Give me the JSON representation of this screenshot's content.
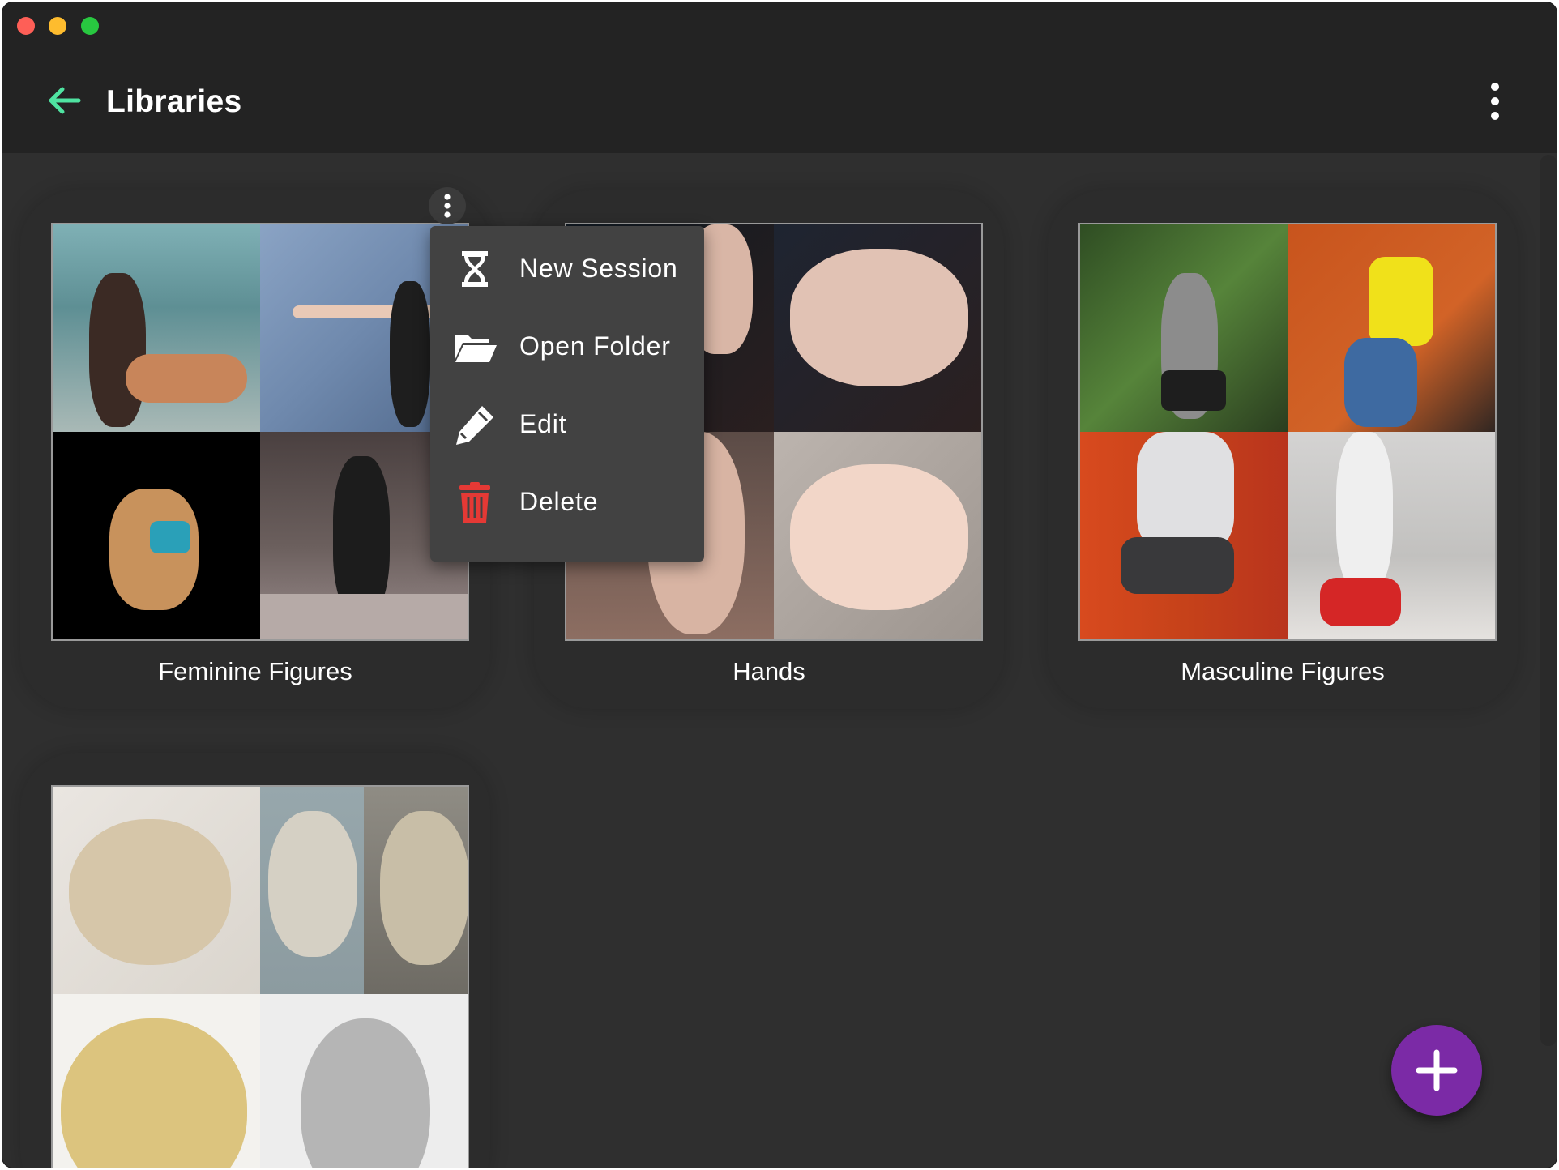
{
  "app": {
    "title": "Libraries"
  },
  "header": {
    "back_icon": "arrow-left-icon",
    "menu_icon": "more-vert-icon",
    "accent": "#4fe3a1"
  },
  "libraries": [
    {
      "label": "Feminine Figures"
    },
    {
      "label": "Hands"
    },
    {
      "label": "Masculine Figures"
    },
    {
      "label": ""
    }
  ],
  "context_menu": {
    "items": [
      {
        "label": "New Session",
        "icon": "hourglass-icon"
      },
      {
        "label": "Open Folder",
        "icon": "folder-open-icon"
      },
      {
        "label": "Edit",
        "icon": "pencil-icon"
      },
      {
        "label": "Delete",
        "icon": "trash-icon",
        "color": "#e53935"
      }
    ]
  },
  "fab": {
    "icon": "plus-icon",
    "color": "#7b2aa6"
  }
}
